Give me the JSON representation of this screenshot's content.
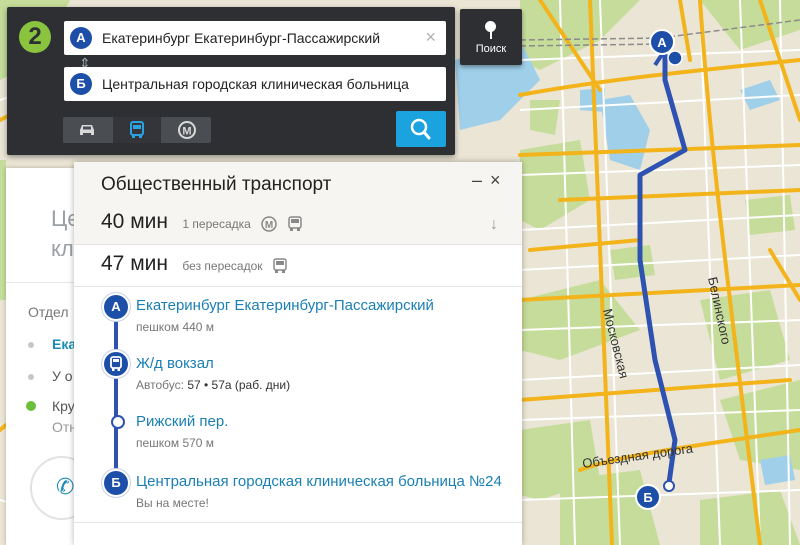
{
  "search": {
    "logo": "2",
    "from": {
      "pin": "А",
      "value": "Екатеринбург Екатеринбург-Пассажирский"
    },
    "to": {
      "pin": "Б",
      "value": "Центральная городская клиническая больница"
    },
    "clear_icon": "×",
    "modes": [
      {
        "name": "car-icon",
        "active": false
      },
      {
        "name": "bus-icon",
        "active": true
      },
      {
        "name": "metro-icon",
        "active": false
      }
    ],
    "metro_letter": "М"
  },
  "search_button": {
    "label": "Поиск",
    "icon": "pin-icon"
  },
  "panel": {
    "title": "Общественный транспорт",
    "minimize": "–",
    "close": "×",
    "options": [
      {
        "duration": "40 мин",
        "note": "1 пересадка",
        "icons": [
          "metro-icon",
          "bus-icon"
        ],
        "expanded": true
      },
      {
        "duration": "47 мин",
        "note": "без пересадок",
        "icons": [
          "bus-icon"
        ],
        "expanded": false
      }
    ],
    "steps": [
      {
        "pin": "А",
        "name": "Екатеринбург Екатеринбург-Пассажирский",
        "sub": "пешком 440 м"
      },
      {
        "pin": "bus-icon",
        "name": "Ж/д вокзал",
        "sub_prefix": "Автобус:",
        "sub_routes": "57 • 57а (раб. дни)"
      },
      {
        "pin": "dot",
        "name": "Рижский пер.",
        "sub": "пешком 570 м"
      },
      {
        "pin": "Б",
        "name": "Центральная городская клиническая больница №24",
        "sub": "Вы на месте!"
      }
    ]
  },
  "background_card": {
    "name": "Цен кли",
    "line1": "Цен",
    "line2": "кли",
    "section": "Отдел",
    "item1": "Ека",
    "item2": "У о",
    "item3": "Кру",
    "item4": "Отн"
  },
  "map": {
    "streets": [
      "Московская",
      "Белинского",
      "Объездная дорога"
    ],
    "pin_a": "А",
    "pin_b": "Б",
    "colors": {
      "route": "#2e52b1",
      "road": "#f2b41a",
      "park": "#c5dc9a",
      "water": "#9fcfe9",
      "land": "#ebe5d5"
    }
  }
}
